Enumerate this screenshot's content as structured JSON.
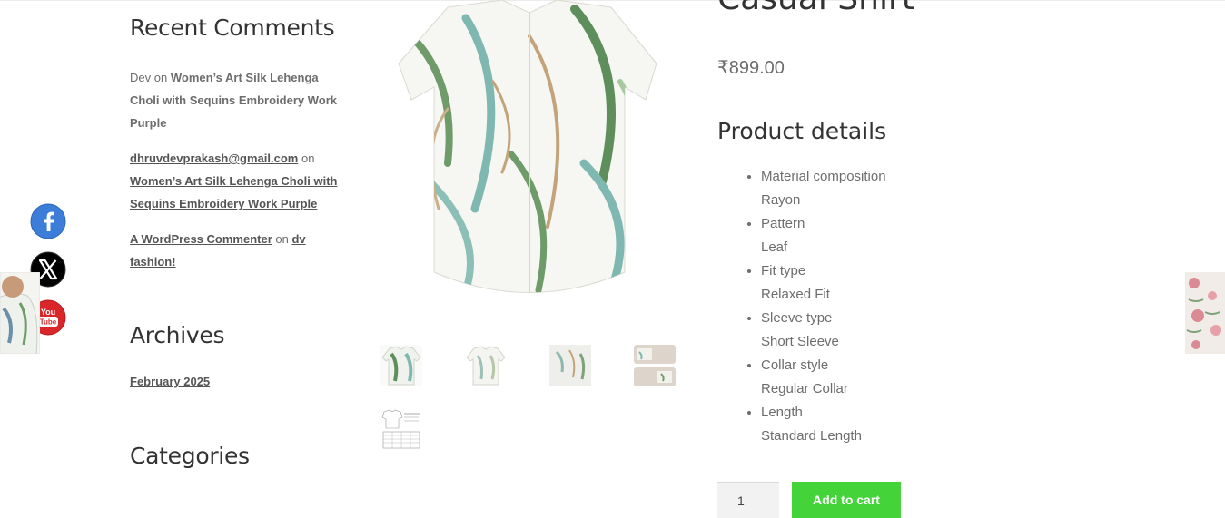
{
  "sidebar": {
    "recent_comments_title": "Recent Comments",
    "comments": [
      {
        "author": "Dev",
        "on": "on",
        "post": "Women’s Art Silk Lehenga Choli with Sequins Embroidery Work Purple"
      },
      {
        "author": "dhruvdevprakash@gmail.com",
        "on": "on",
        "post": "Women’s Art Silk Lehenga Choli with Sequins Embroidery Work Purple"
      },
      {
        "author": "A WordPress Commenter",
        "on": "on",
        "post": "dv fashion!"
      }
    ],
    "archives_title": "Archives",
    "archive_link": "February 2025",
    "categories_title": "Categories"
  },
  "product": {
    "title": "Casual Shirt",
    "price": "₹899.00",
    "details_heading": "Product details",
    "details": [
      {
        "label": "Material composition",
        "value": "Rayon"
      },
      {
        "label": "Pattern",
        "value": "Leaf"
      },
      {
        "label": "Fit type",
        "value": "Relaxed Fit"
      },
      {
        "label": "Sleeve type",
        "value": "Short Sleeve"
      },
      {
        "label": "Collar style",
        "value": "Regular Collar"
      },
      {
        "label": "Length",
        "value": "Standard Length"
      }
    ],
    "quantity": "1",
    "add_to_cart": "Add to cart"
  },
  "social": [
    {
      "name": "facebook-icon",
      "glyph": "f",
      "color": "#3b7dd8"
    },
    {
      "name": "x-icon",
      "glyph": "X",
      "color": "#000000"
    },
    {
      "name": "youtube-icon",
      "glyph": "You Tube",
      "color": "#d8262a"
    }
  ],
  "colors": {
    "accent_button": "#45d33a",
    "heading": "#333333",
    "text": "#6d6d6d"
  }
}
